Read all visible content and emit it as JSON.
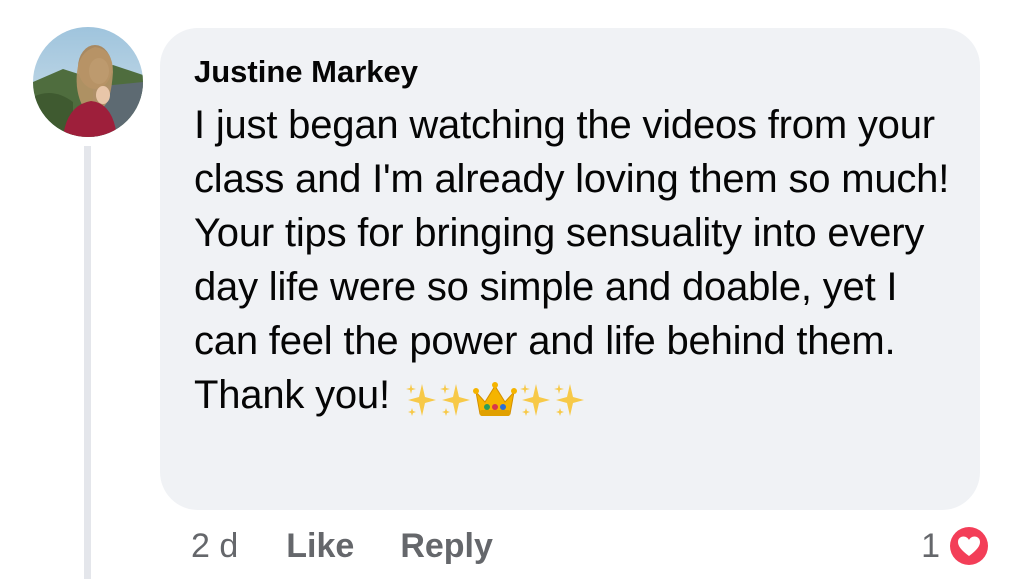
{
  "comment": {
    "author": "Justine Markey",
    "text": "I just began watching the videos from your class and I'm already loving them so much! Your tips for bringing sensuality into every day life were so simple and doable, yet I can feel the power and life behind them. Thank you!",
    "emojis": [
      "sparkles",
      "sparkles",
      "crown",
      "sparkles",
      "sparkles"
    ]
  },
  "actions": {
    "time": "2 d",
    "like_label": "Like",
    "reply_label": "Reply"
  },
  "reactions": {
    "count": "1",
    "type": "love-icon",
    "color": "#f33e58"
  },
  "colors": {
    "bubble": "#f0f2f5",
    "meta_text": "#65676b",
    "thread_line": "#e4e6eb"
  }
}
